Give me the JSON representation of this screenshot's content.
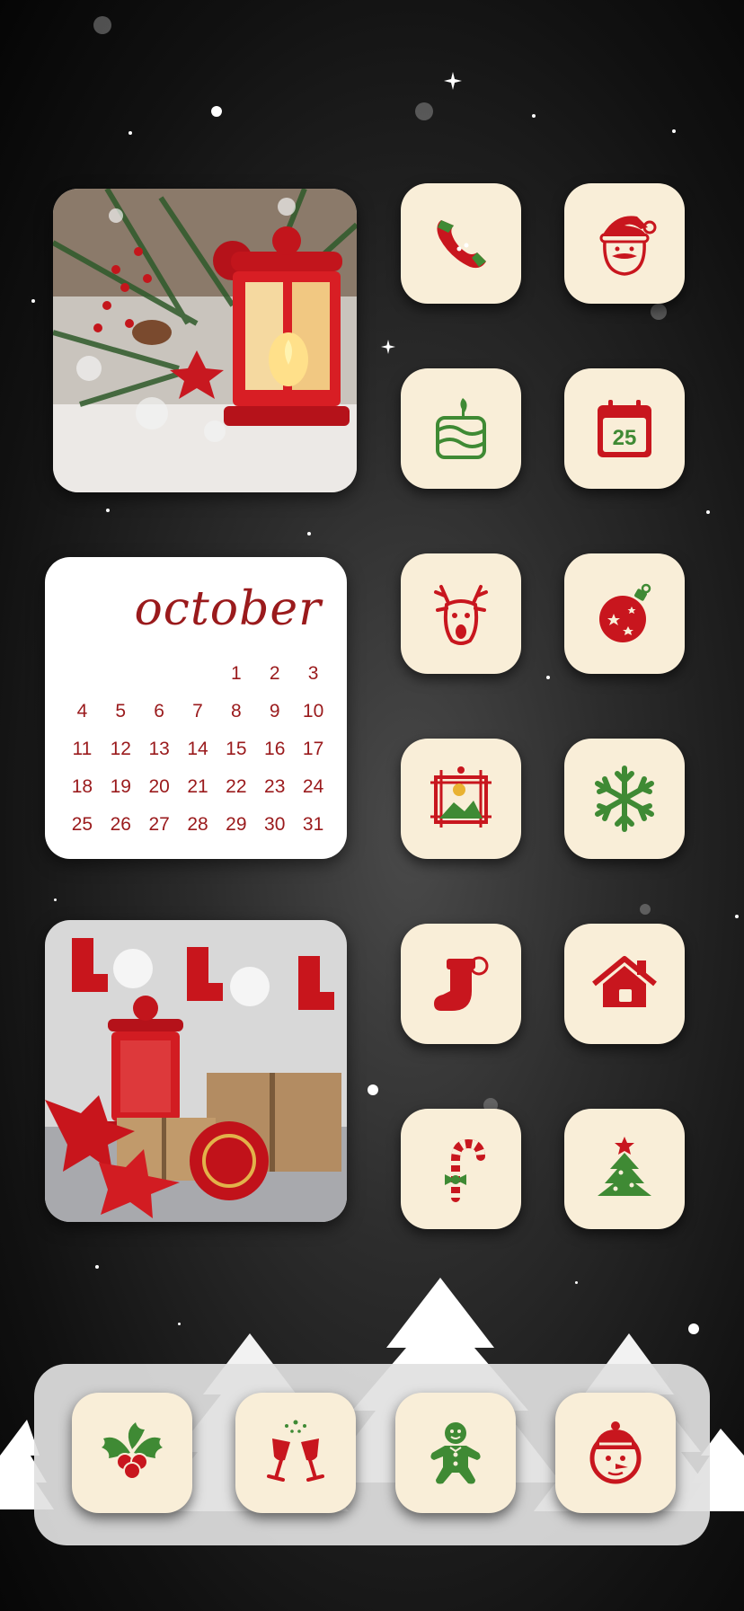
{
  "calendar_widget": {
    "month": "october",
    "days": [
      "",
      "",
      "",
      "",
      "1",
      "2",
      "3",
      "4",
      "5",
      "6",
      "7",
      "8",
      "9",
      "10",
      "11",
      "12",
      "13",
      "14",
      "15",
      "16",
      "17",
      "18",
      "19",
      "20",
      "21",
      "22",
      "23",
      "24",
      "25",
      "26",
      "27",
      "28",
      "29",
      "30",
      "31"
    ]
  },
  "calendar_app_icon": {
    "date": "25"
  },
  "home_apps": [
    {
      "icon": "phone-icon"
    },
    {
      "icon": "santa-icon"
    },
    {
      "icon": "gift-box-icon"
    },
    {
      "icon": "calendar-icon"
    },
    {
      "icon": "reindeer-icon"
    },
    {
      "icon": "ornament-icon"
    },
    {
      "icon": "photo-frame-icon"
    },
    {
      "icon": "snowflake-icon"
    },
    {
      "icon": "stocking-icon"
    },
    {
      "icon": "house-icon"
    },
    {
      "icon": "candy-cane-icon"
    },
    {
      "icon": "christmas-tree-icon"
    }
  ],
  "dock_apps": [
    {
      "icon": "holly-icon"
    },
    {
      "icon": "champagne-glasses-icon"
    },
    {
      "icon": "gingerbread-man-icon"
    },
    {
      "icon": "snowman-icon"
    }
  ],
  "colors": {
    "red": "#b3181f",
    "green": "#3f8a34",
    "tile": "#f9eed8",
    "month_text": "#9a1a1c"
  }
}
